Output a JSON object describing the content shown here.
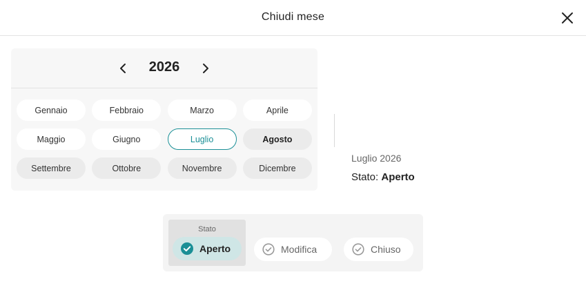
{
  "dialog": {
    "title": "Chiudi mese"
  },
  "calendar": {
    "year": "2026",
    "months": [
      {
        "label": "Gennaio",
        "state": "open"
      },
      {
        "label": "Febbraio",
        "state": "open"
      },
      {
        "label": "Marzo",
        "state": "open"
      },
      {
        "label": "Aprile",
        "state": "open"
      },
      {
        "label": "Maggio",
        "state": "open"
      },
      {
        "label": "Giugno",
        "state": "open"
      },
      {
        "label": "Luglio",
        "state": "selected"
      },
      {
        "label": "Agosto",
        "state": "current"
      },
      {
        "label": "Settembre",
        "state": "closed"
      },
      {
        "label": "Ottobre",
        "state": "closed"
      },
      {
        "label": "Novembre",
        "state": "closed"
      },
      {
        "label": "Dicembre",
        "state": "closed"
      }
    ]
  },
  "info": {
    "period": "Luglio 2026",
    "status_prefix": "Stato:",
    "status_value": "Aperto"
  },
  "status_selector": {
    "label": "Stato",
    "options": [
      {
        "label": "Aperto",
        "selected": true
      },
      {
        "label": "Modifica",
        "selected": false
      },
      {
        "label": "Chiuso",
        "selected": false
      }
    ]
  },
  "colors": {
    "accent": "#1a8f96",
    "selected_chip_bg": "#cfe6e6"
  }
}
